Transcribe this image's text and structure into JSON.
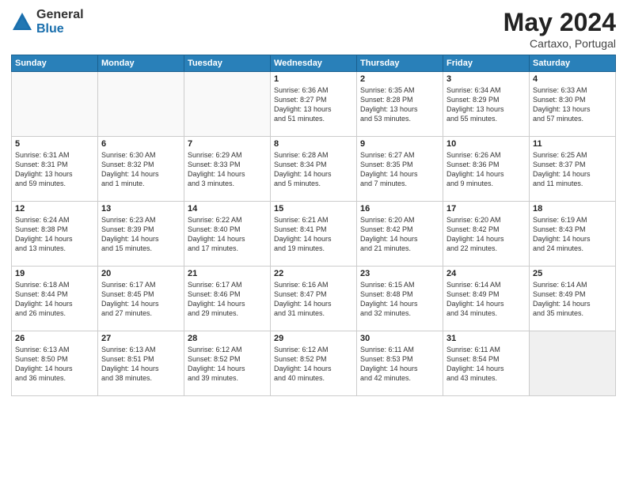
{
  "header": {
    "logo_general": "General",
    "logo_blue": "Blue",
    "title": "May 2024",
    "location": "Cartaxo, Portugal"
  },
  "weekdays": [
    "Sunday",
    "Monday",
    "Tuesday",
    "Wednesday",
    "Thursday",
    "Friday",
    "Saturday"
  ],
  "weeks": [
    [
      {
        "day": "",
        "info": "",
        "empty": true
      },
      {
        "day": "",
        "info": "",
        "empty": true
      },
      {
        "day": "",
        "info": "",
        "empty": true
      },
      {
        "day": "1",
        "info": "Sunrise: 6:36 AM\nSunset: 8:27 PM\nDaylight: 13 hours\nand 51 minutes.",
        "empty": false
      },
      {
        "day": "2",
        "info": "Sunrise: 6:35 AM\nSunset: 8:28 PM\nDaylight: 13 hours\nand 53 minutes.",
        "empty": false
      },
      {
        "day": "3",
        "info": "Sunrise: 6:34 AM\nSunset: 8:29 PM\nDaylight: 13 hours\nand 55 minutes.",
        "empty": false
      },
      {
        "day": "4",
        "info": "Sunrise: 6:33 AM\nSunset: 8:30 PM\nDaylight: 13 hours\nand 57 minutes.",
        "empty": false
      }
    ],
    [
      {
        "day": "5",
        "info": "Sunrise: 6:31 AM\nSunset: 8:31 PM\nDaylight: 13 hours\nand 59 minutes.",
        "empty": false
      },
      {
        "day": "6",
        "info": "Sunrise: 6:30 AM\nSunset: 8:32 PM\nDaylight: 14 hours\nand 1 minute.",
        "empty": false
      },
      {
        "day": "7",
        "info": "Sunrise: 6:29 AM\nSunset: 8:33 PM\nDaylight: 14 hours\nand 3 minutes.",
        "empty": false
      },
      {
        "day": "8",
        "info": "Sunrise: 6:28 AM\nSunset: 8:34 PM\nDaylight: 14 hours\nand 5 minutes.",
        "empty": false
      },
      {
        "day": "9",
        "info": "Sunrise: 6:27 AM\nSunset: 8:35 PM\nDaylight: 14 hours\nand 7 minutes.",
        "empty": false
      },
      {
        "day": "10",
        "info": "Sunrise: 6:26 AM\nSunset: 8:36 PM\nDaylight: 14 hours\nand 9 minutes.",
        "empty": false
      },
      {
        "day": "11",
        "info": "Sunrise: 6:25 AM\nSunset: 8:37 PM\nDaylight: 14 hours\nand 11 minutes.",
        "empty": false
      }
    ],
    [
      {
        "day": "12",
        "info": "Sunrise: 6:24 AM\nSunset: 8:38 PM\nDaylight: 14 hours\nand 13 minutes.",
        "empty": false
      },
      {
        "day": "13",
        "info": "Sunrise: 6:23 AM\nSunset: 8:39 PM\nDaylight: 14 hours\nand 15 minutes.",
        "empty": false
      },
      {
        "day": "14",
        "info": "Sunrise: 6:22 AM\nSunset: 8:40 PM\nDaylight: 14 hours\nand 17 minutes.",
        "empty": false
      },
      {
        "day": "15",
        "info": "Sunrise: 6:21 AM\nSunset: 8:41 PM\nDaylight: 14 hours\nand 19 minutes.",
        "empty": false
      },
      {
        "day": "16",
        "info": "Sunrise: 6:20 AM\nSunset: 8:42 PM\nDaylight: 14 hours\nand 21 minutes.",
        "empty": false
      },
      {
        "day": "17",
        "info": "Sunrise: 6:20 AM\nSunset: 8:42 PM\nDaylight: 14 hours\nand 22 minutes.",
        "empty": false
      },
      {
        "day": "18",
        "info": "Sunrise: 6:19 AM\nSunset: 8:43 PM\nDaylight: 14 hours\nand 24 minutes.",
        "empty": false
      }
    ],
    [
      {
        "day": "19",
        "info": "Sunrise: 6:18 AM\nSunset: 8:44 PM\nDaylight: 14 hours\nand 26 minutes.",
        "empty": false
      },
      {
        "day": "20",
        "info": "Sunrise: 6:17 AM\nSunset: 8:45 PM\nDaylight: 14 hours\nand 27 minutes.",
        "empty": false
      },
      {
        "day": "21",
        "info": "Sunrise: 6:17 AM\nSunset: 8:46 PM\nDaylight: 14 hours\nand 29 minutes.",
        "empty": false
      },
      {
        "day": "22",
        "info": "Sunrise: 6:16 AM\nSunset: 8:47 PM\nDaylight: 14 hours\nand 31 minutes.",
        "empty": false
      },
      {
        "day": "23",
        "info": "Sunrise: 6:15 AM\nSunset: 8:48 PM\nDaylight: 14 hours\nand 32 minutes.",
        "empty": false
      },
      {
        "day": "24",
        "info": "Sunrise: 6:14 AM\nSunset: 8:49 PM\nDaylight: 14 hours\nand 34 minutes.",
        "empty": false
      },
      {
        "day": "25",
        "info": "Sunrise: 6:14 AM\nSunset: 8:49 PM\nDaylight: 14 hours\nand 35 minutes.",
        "empty": false
      }
    ],
    [
      {
        "day": "26",
        "info": "Sunrise: 6:13 AM\nSunset: 8:50 PM\nDaylight: 14 hours\nand 36 minutes.",
        "empty": false
      },
      {
        "day": "27",
        "info": "Sunrise: 6:13 AM\nSunset: 8:51 PM\nDaylight: 14 hours\nand 38 minutes.",
        "empty": false
      },
      {
        "day": "28",
        "info": "Sunrise: 6:12 AM\nSunset: 8:52 PM\nDaylight: 14 hours\nand 39 minutes.",
        "empty": false
      },
      {
        "day": "29",
        "info": "Sunrise: 6:12 AM\nSunset: 8:52 PM\nDaylight: 14 hours\nand 40 minutes.",
        "empty": false
      },
      {
        "day": "30",
        "info": "Sunrise: 6:11 AM\nSunset: 8:53 PM\nDaylight: 14 hours\nand 42 minutes.",
        "empty": false
      },
      {
        "day": "31",
        "info": "Sunrise: 6:11 AM\nSunset: 8:54 PM\nDaylight: 14 hours\nand 43 minutes.",
        "empty": false
      },
      {
        "day": "",
        "info": "",
        "empty": true
      }
    ]
  ]
}
